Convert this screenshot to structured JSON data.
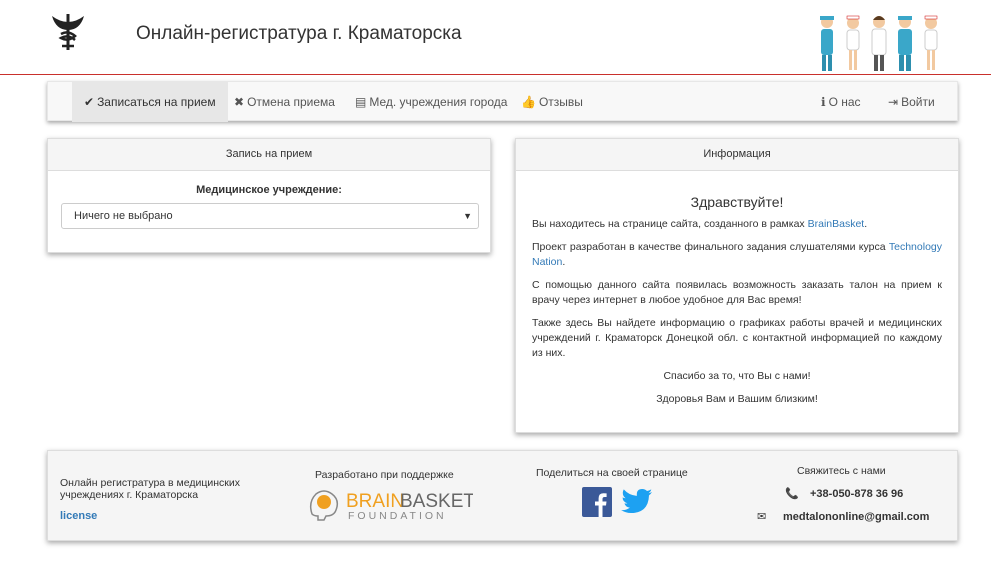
{
  "header": {
    "title": "Онлайн-регистратура г. Краматорска"
  },
  "nav": {
    "items": [
      {
        "label": "Записаться на прием",
        "icon": "check-icon",
        "glyph": "✔"
      },
      {
        "label": "Отмена приема",
        "icon": "close-icon",
        "glyph": "✖"
      },
      {
        "label": "Мед. учреждения города",
        "icon": "list-icon",
        "glyph": "▤"
      },
      {
        "label": "Отзывы",
        "icon": "thumbs-up-icon",
        "glyph": "👍"
      }
    ],
    "about": {
      "label": "О нас",
      "glyph": "ℹ"
    },
    "login": {
      "label": "Войти",
      "glyph": "⇥"
    }
  },
  "appointment": {
    "heading": "Запись на прием",
    "label": "Медицинское учреждение:",
    "selected": "Ничего не выбрано"
  },
  "info": {
    "heading": "Информация",
    "greeting": "Здравствуйте!",
    "p1_text": "Вы находитесь на странице сайта, созданного в рамках ",
    "p1_link": "BrainBasket",
    "p1_end": ".",
    "p2_text": "Проект разработан в качестве финального задания слушателями курса ",
    "p2_link": "Technology Nation",
    "p2_end": ".",
    "p3": "С помощью данного сайта появилась возможность заказать талон на прием к врачу через интернет в любое удобное для Вас время!",
    "p4": "Также здесь Вы найдете информацию о графиках работы врачей и медицинских учреждений г. Краматорск Донецкой обл. с контактной информацией по каждому из них.",
    "p5": "Спасибо за то, что Вы с нами!",
    "p6": "Здоровья Вам и Вашим близким!"
  },
  "footer": {
    "about": "Онлайн регистратура в медицинских учреждениях г. Краматорска",
    "license": "license",
    "support_title": "Разработано при поддержке",
    "brand_a": "BRAIN",
    "brand_b": "BASKET",
    "brand_sub": "FOUNDATION",
    "share_title": "Поделиться на своей странице",
    "contact_title": "Свяжитесь с нами",
    "phone": "+38-050-878 36 96",
    "email": "medtalononline@gmail.com",
    "colors": {
      "facebook": "#3b5998",
      "twitter": "#1da1f2",
      "brand_orange": "#f0a020",
      "link": "#337ab7"
    }
  }
}
